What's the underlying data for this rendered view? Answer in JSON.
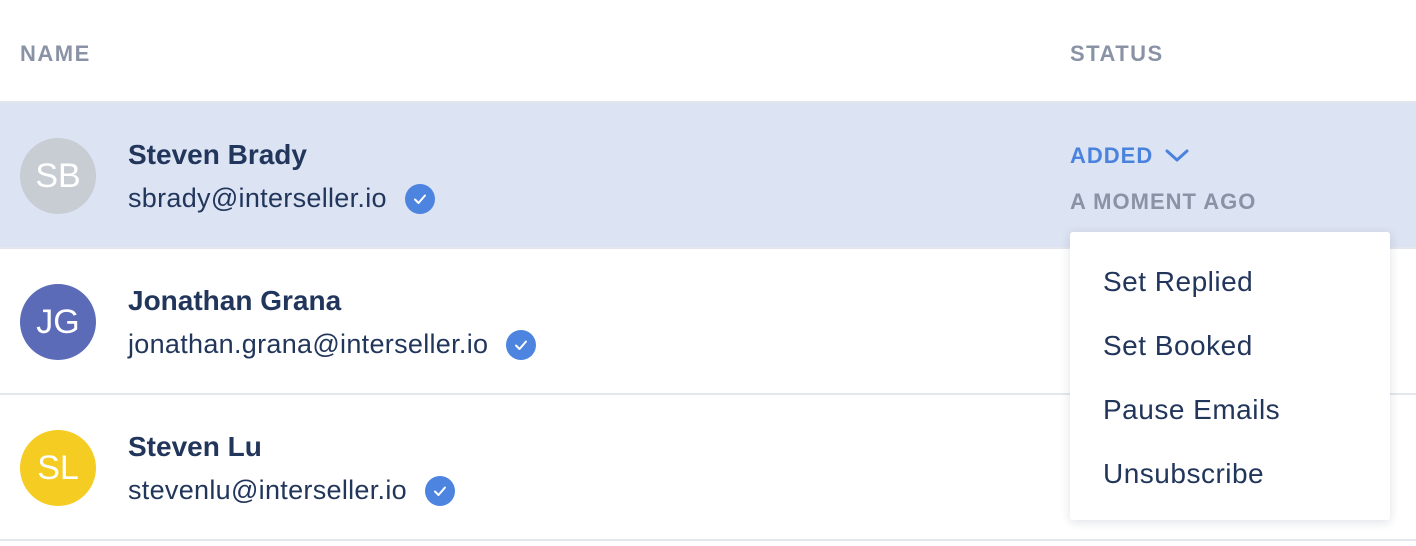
{
  "header": {
    "name_label": "NAME",
    "status_label": "STATUS"
  },
  "colors": {
    "selected_row": "#dce3f3",
    "accent": "#4a83de",
    "text_primary": "#22365c",
    "text_muted": "#8a93a6"
  },
  "rows": [
    {
      "initials": "SB",
      "avatar_color": "#c8ccd3",
      "name": "Steven Brady",
      "email": "sbrady@interseller.io",
      "verified_icon": "check-circle-icon",
      "selected": true,
      "status": "ADDED",
      "status_time": "A MOMENT AGO"
    },
    {
      "initials": "JG",
      "avatar_color": "#5b6bb8",
      "name": "Jonathan Grana",
      "email": "jonathan.grana@interseller.io",
      "verified_icon": "check-circle-icon",
      "selected": false
    },
    {
      "initials": "SL",
      "avatar_color": "#f5cc22",
      "name": "Steven Lu",
      "email": "stevenlu@interseller.io",
      "verified_icon": "check-circle-icon",
      "selected": false
    }
  ],
  "status_menu": {
    "items": [
      "Set Replied",
      "Set Booked",
      "Pause Emails",
      "Unsubscribe"
    ]
  }
}
